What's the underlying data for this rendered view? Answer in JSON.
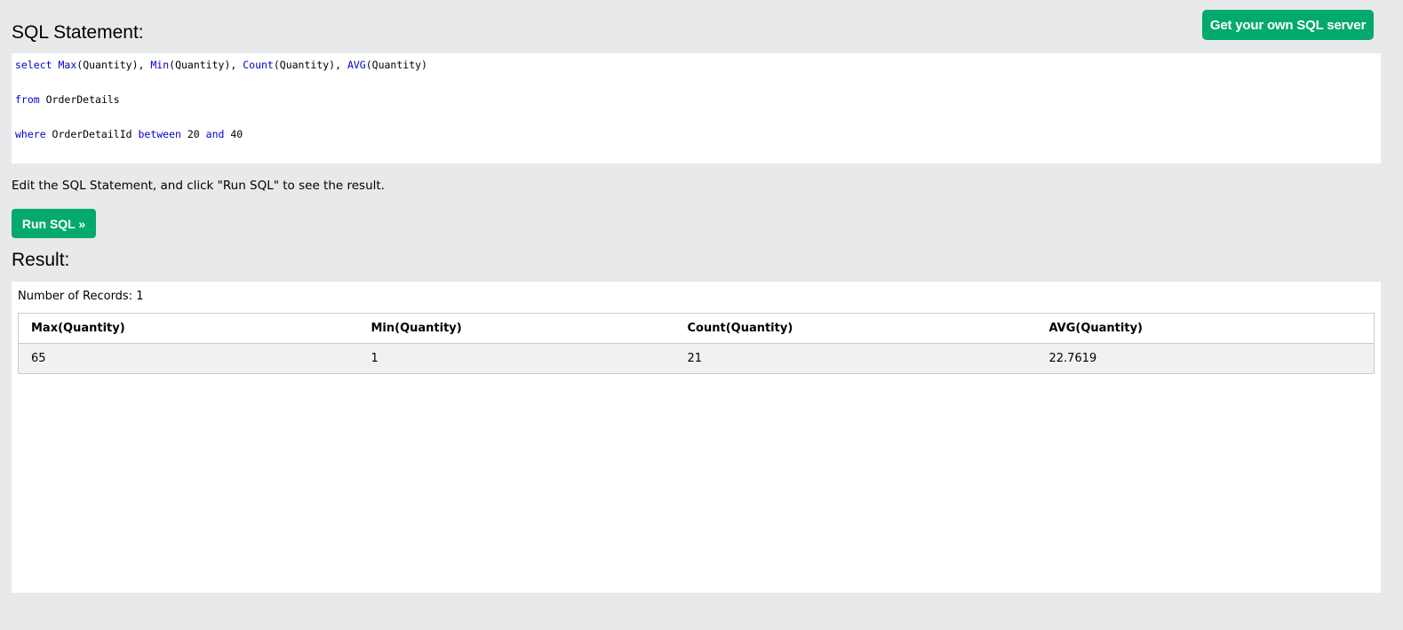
{
  "header": {
    "get_server_label": "Get your own SQL server"
  },
  "sql": {
    "heading": "SQL Statement:",
    "lines": [
      [
        {
          "t": "select",
          "c": "kw"
        },
        {
          "t": " "
        },
        {
          "t": "Max",
          "c": "fn"
        },
        {
          "t": "(Quantity), "
        },
        {
          "t": "Min",
          "c": "fn"
        },
        {
          "t": "(Quantity), "
        },
        {
          "t": "Count",
          "c": "fn"
        },
        {
          "t": "(Quantity), "
        },
        {
          "t": "AVG",
          "c": "fn"
        },
        {
          "t": "(Quantity)"
        }
      ],
      [
        {
          "t": "from",
          "c": "kw"
        },
        {
          "t": " OrderDetails"
        }
      ],
      [
        {
          "t": "where",
          "c": "kw"
        },
        {
          "t": " OrderDetailId "
        },
        {
          "t": "between",
          "c": "kw"
        },
        {
          "t": " 20 "
        },
        {
          "t": "and",
          "c": "kw"
        },
        {
          "t": " 40"
        }
      ]
    ],
    "instructions": "Edit the SQL Statement, and click \"Run SQL\" to see the result.",
    "run_label": "Run SQL »"
  },
  "result": {
    "heading": "Result:",
    "record_count": "Number of Records: 1",
    "columns": [
      "Max(Quantity)",
      "Min(Quantity)",
      "Count(Quantity)",
      "AVG(Quantity)"
    ],
    "rows": [
      [
        "65",
        "1",
        "21",
        "22.7619"
      ]
    ]
  },
  "colors": {
    "accent": "#04aa6d",
    "background": "#e7e9eb",
    "keyword": "#0000cd"
  }
}
